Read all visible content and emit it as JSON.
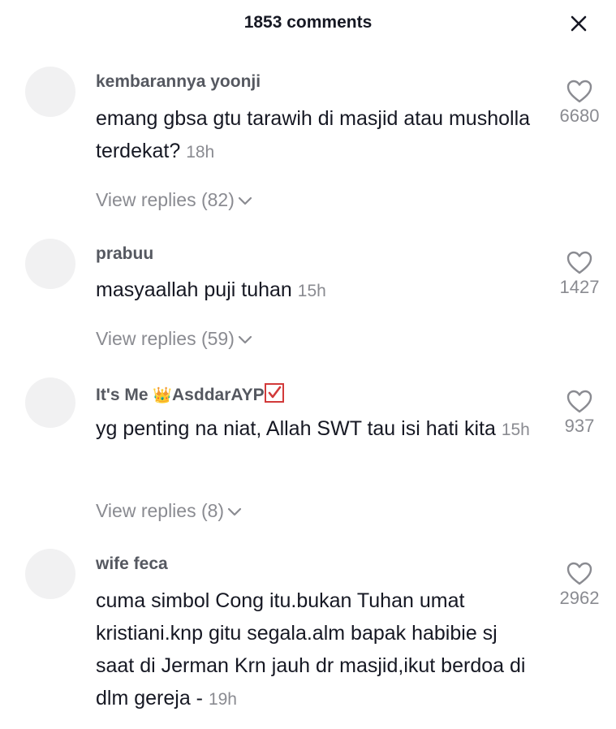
{
  "header": {
    "title": "1853 comments",
    "close_icon": "close-icon"
  },
  "comments": [
    {
      "username": "kembarannya yoonji",
      "text": "emang gbsa gtu tarawih di masjid atau musholla terdekat?",
      "time": "18h",
      "likes": "6680",
      "replies": "View replies (82)"
    },
    {
      "username": "prabuu",
      "text": "masyaallah puji tuhan",
      "time": "15h",
      "likes": "1427",
      "replies": "View replies (59)"
    },
    {
      "username_prefix": "It's Me ",
      "username_emoji": "👑",
      "username_suffix": "AsddarAYP",
      "username_badge": "check-mark-icon",
      "text": "yg penting na niat, Allah SWT tau isi hati kita",
      "time": "15h",
      "likes": "937",
      "replies": "View replies (8)"
    },
    {
      "username": "wife feca",
      "text": "cuma simbol Cong itu.bukan Tuhan umat kristiani.knp gitu segala.alm bapak habibie sj saat di Jerman Krn jauh dr masjid,ikut berdoa di dlm gereja -",
      "time": "19h",
      "likes": "2962"
    }
  ],
  "colors": {
    "primary_text": "#161823",
    "secondary_text": "#8a8b91",
    "avatar_placeholder": "#f1f1f2",
    "check_badge": "#d23a3a"
  }
}
